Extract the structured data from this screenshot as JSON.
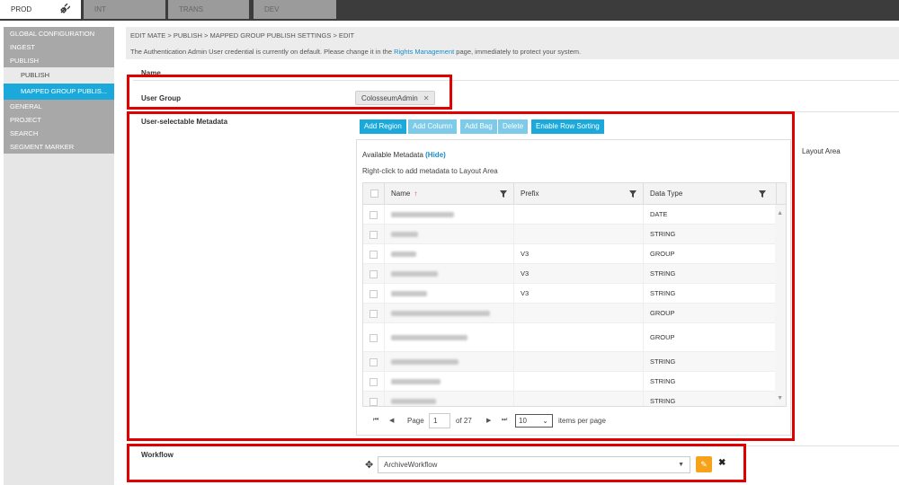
{
  "env_tabs": [
    {
      "label": "PROD",
      "active": true
    },
    {
      "label": "INT",
      "active": false
    },
    {
      "label": "TRANS",
      "active": false
    },
    {
      "label": "DEV",
      "active": false
    }
  ],
  "sidebar": {
    "items": [
      {
        "label": "GLOBAL CONFIGURATION"
      },
      {
        "label": "INGEST"
      },
      {
        "label": "PUBLISH"
      },
      {
        "label": "PUBLISH"
      },
      {
        "label": "MAPPED GROUP PUBLIS..."
      },
      {
        "label": "GENERAL"
      },
      {
        "label": "PROJECT"
      },
      {
        "label": "SEARCH"
      },
      {
        "label": "SEGMENT MARKER"
      }
    ]
  },
  "header": {
    "breadcrumb": "EDIT MATE > PUBLISH > MAPPED GROUP PUBLISH SETTINGS > EDIT",
    "warning_pre": "The Authentication Admin User credential is currently on default. Please change it in the ",
    "warning_link": "Rights Management",
    "warning_post": " page, immediately to protect your system."
  },
  "form": {
    "name_label": "Name",
    "user_group_label": "User Group",
    "user_group_tag": "ColosseumAdmin",
    "tag_remove": "✕",
    "metadata_label": "User-selectable Metadata",
    "workflow_label": "Workflow",
    "workflow_value": "ArchiveWorkflow",
    "layout_area_label": "Layout Area"
  },
  "toolbar": {
    "add_region": "Add Region",
    "add_column": "Add Column",
    "add_bag": "Add Bag",
    "delete": "Delete",
    "enable_row_sorting": "Enable Row Sorting"
  },
  "metadata_panel": {
    "title": "Available Metadata",
    "hide_link": "(Hide)",
    "hint": "Right-click to add metadata to Layout Area",
    "columns": [
      "Name",
      "Prefix",
      "Data Type"
    ],
    "sort_indicator": "↑",
    "rows": [
      {
        "prefix": "",
        "type": "DATE"
      },
      {
        "prefix": "",
        "type": "STRING"
      },
      {
        "prefix": "V3",
        "type": "GROUP"
      },
      {
        "prefix": "V3",
        "type": "STRING"
      },
      {
        "prefix": "V3",
        "type": "STRING"
      },
      {
        "prefix": "",
        "type": "GROUP"
      },
      {
        "prefix": "",
        "type": "GROUP"
      },
      {
        "prefix": "",
        "type": "STRING"
      },
      {
        "prefix": "",
        "type": "STRING"
      },
      {
        "prefix": "",
        "type": "STRING"
      }
    ]
  },
  "pager": {
    "page_label": "Page",
    "page_value": "1",
    "of_label": "of 27",
    "page_size": "10",
    "items_per_page": "items per page"
  },
  "colors": {
    "accent": "#1ba9dc",
    "highlight_box": "#e00000",
    "edit_button": "#f7a21b"
  }
}
